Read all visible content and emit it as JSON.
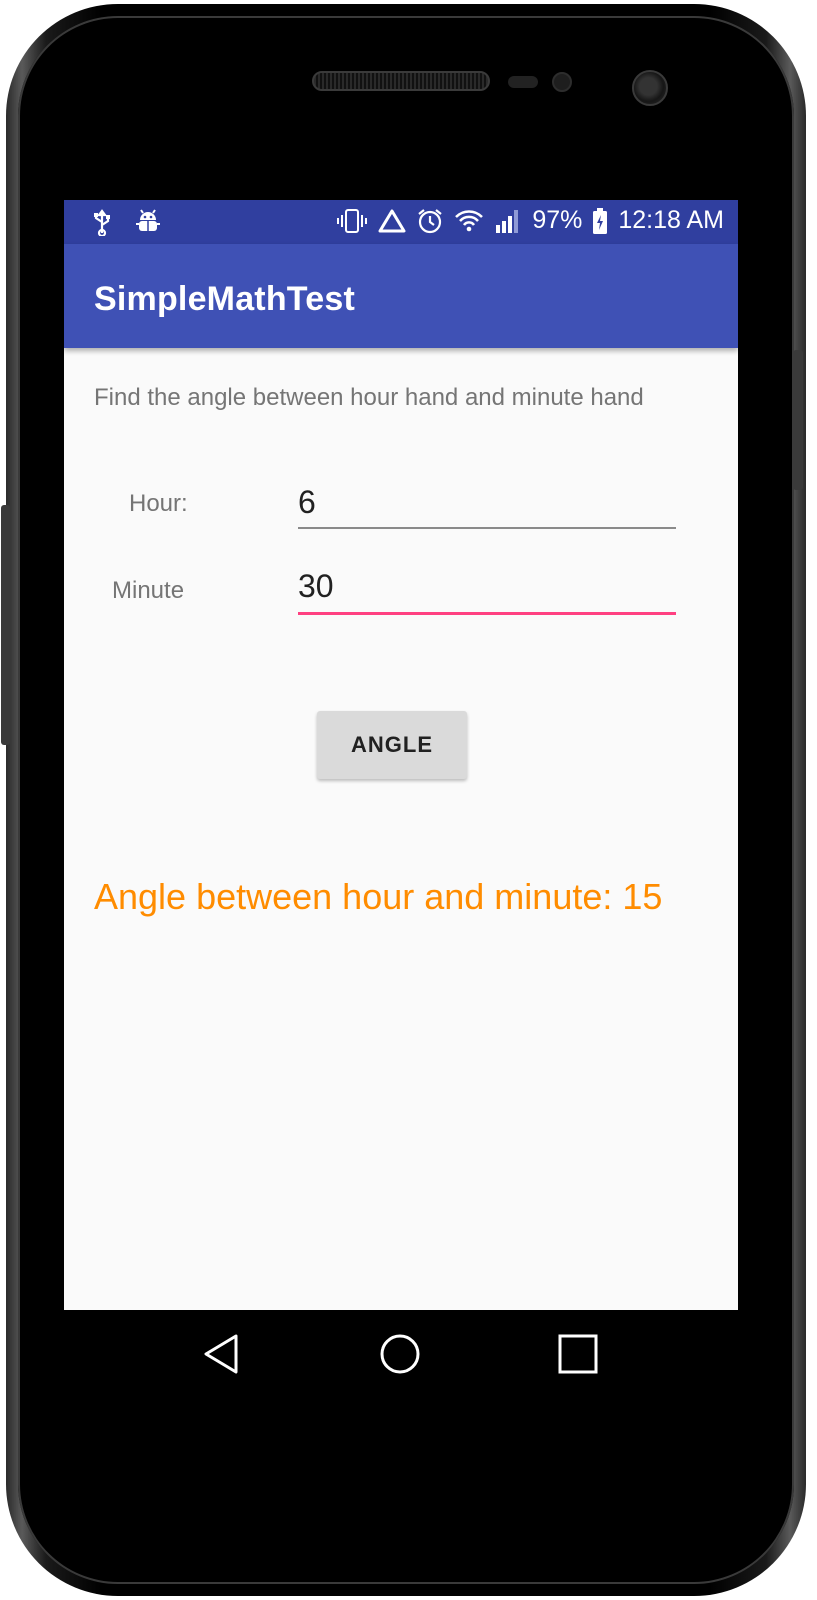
{
  "status_bar": {
    "icons_left": [
      "usb-icon",
      "android-debug-icon"
    ],
    "icons_right": [
      "vibrate-icon",
      "warning-triangle-icon",
      "alarm-icon",
      "wifi-icon",
      "signal-icon"
    ],
    "battery": "97%",
    "time": "12:18 AM"
  },
  "app_bar": {
    "title": "SimpleMathTest"
  },
  "main": {
    "instruction": "Find the angle between hour hand and minute hand",
    "hour_label": "Hour:",
    "hour_value": "6",
    "minute_label": "Minute",
    "minute_value": "30",
    "angle_button": "ANGLE",
    "result": "Angle between hour and minute: 15"
  },
  "nav_bar": {
    "items": [
      "back-icon",
      "home-icon",
      "recents-icon"
    ]
  },
  "colors": {
    "status_bar": "#303f9f",
    "app_bar": "#3f51b5",
    "accent": "#ff4081",
    "result_text": "#ff8c00"
  }
}
